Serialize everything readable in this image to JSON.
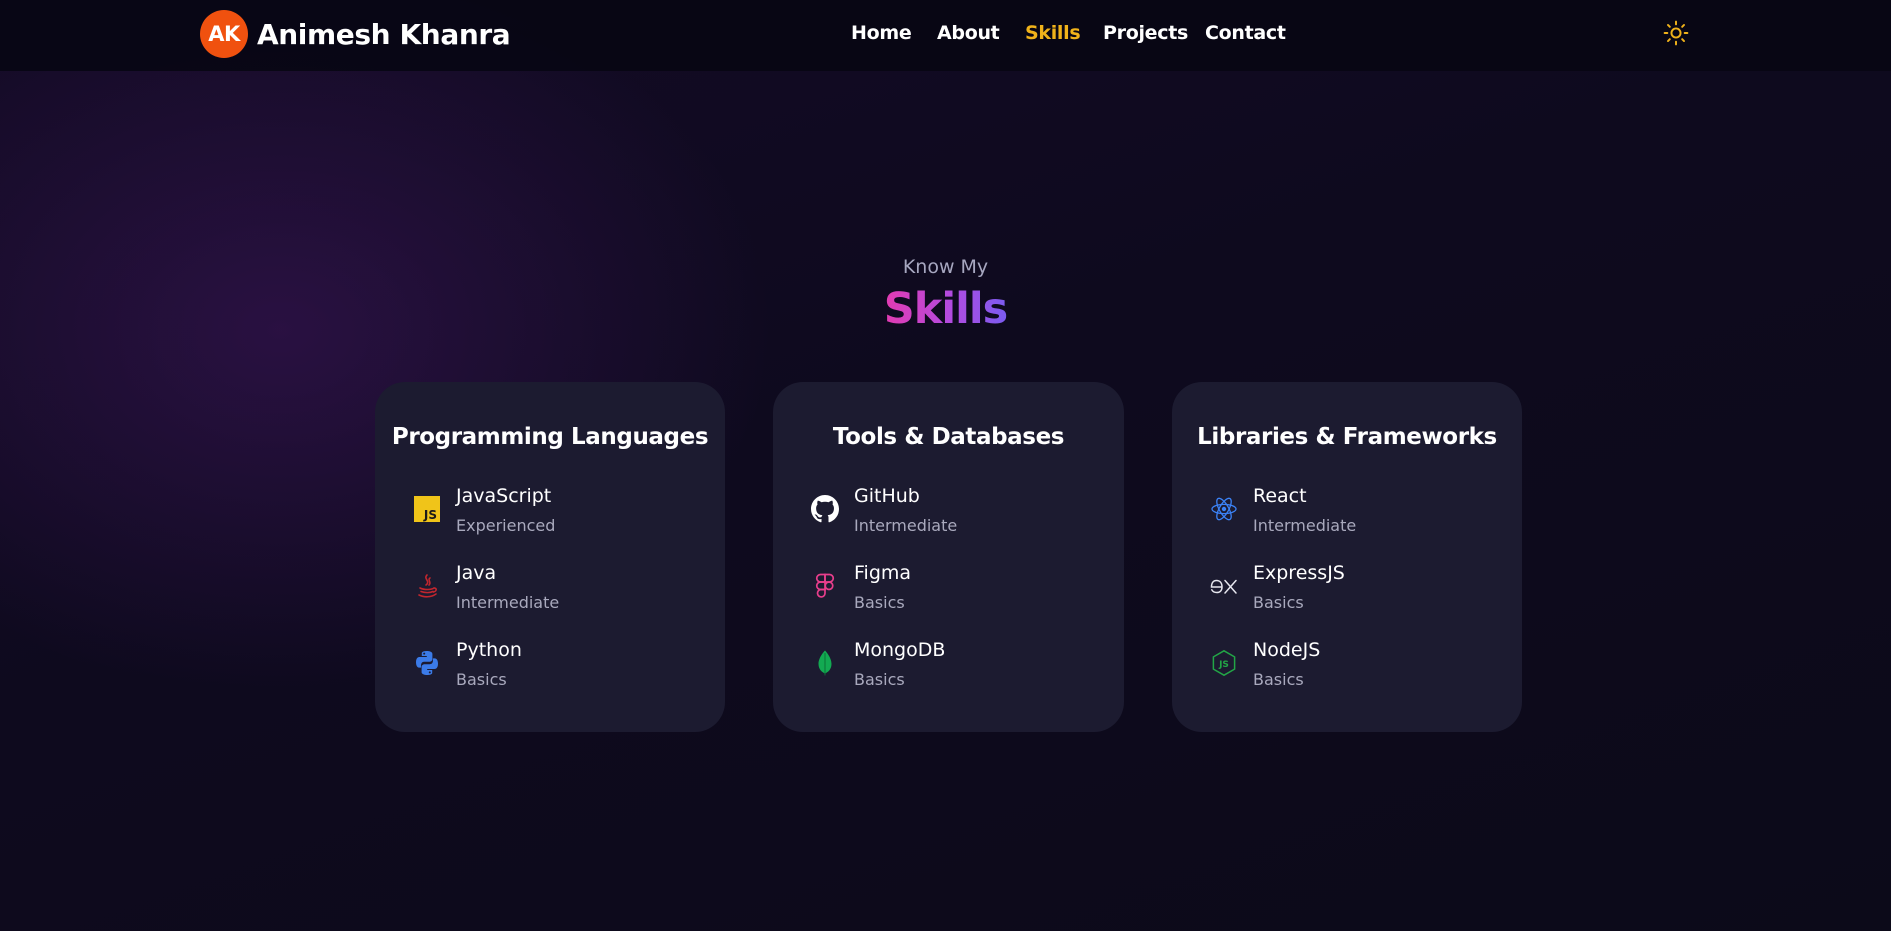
{
  "header": {
    "logo_initials": "AK",
    "name": "Animesh Khanra",
    "nav": [
      {
        "label": "Home",
        "active": false
      },
      {
        "label": "About",
        "active": false
      },
      {
        "label": "Skills",
        "active": true
      },
      {
        "label": "Projects",
        "active": false
      },
      {
        "label": "Contact",
        "active": false
      }
    ],
    "theme_toggle_icon": "sun-icon"
  },
  "section": {
    "subtitle": "Know My",
    "title": "Skills"
  },
  "cards": [
    {
      "title": "Programming Languages",
      "skills": [
        {
          "name": "JavaScript",
          "level": "Experienced",
          "icon": "javascript-icon"
        },
        {
          "name": "Java",
          "level": "Intermediate",
          "icon": "java-icon"
        },
        {
          "name": "Python",
          "level": "Basics",
          "icon": "python-icon"
        }
      ]
    },
    {
      "title": "Tools & Databases",
      "skills": [
        {
          "name": "GitHub",
          "level": "Intermediate",
          "icon": "github-icon"
        },
        {
          "name": "Figma",
          "level": "Basics",
          "icon": "figma-icon"
        },
        {
          "name": "MongoDB",
          "level": "Basics",
          "icon": "mongodb-icon"
        }
      ]
    },
    {
      "title": "Libraries & Frameworks",
      "skills": [
        {
          "name": "React",
          "level": "Intermediate",
          "icon": "react-icon"
        },
        {
          "name": "ExpressJS",
          "level": "Basics",
          "icon": "express-icon"
        },
        {
          "name": "NodeJS",
          "level": "Basics",
          "icon": "nodejs-icon"
        }
      ]
    }
  ],
  "colors": {
    "accent_nav_active": "#f0b21a",
    "logo_badge": "#f0510f",
    "card_background": "#1c1b30",
    "title_gradient_start": "#e33bb1",
    "title_gradient_end": "#7b5cf0"
  }
}
